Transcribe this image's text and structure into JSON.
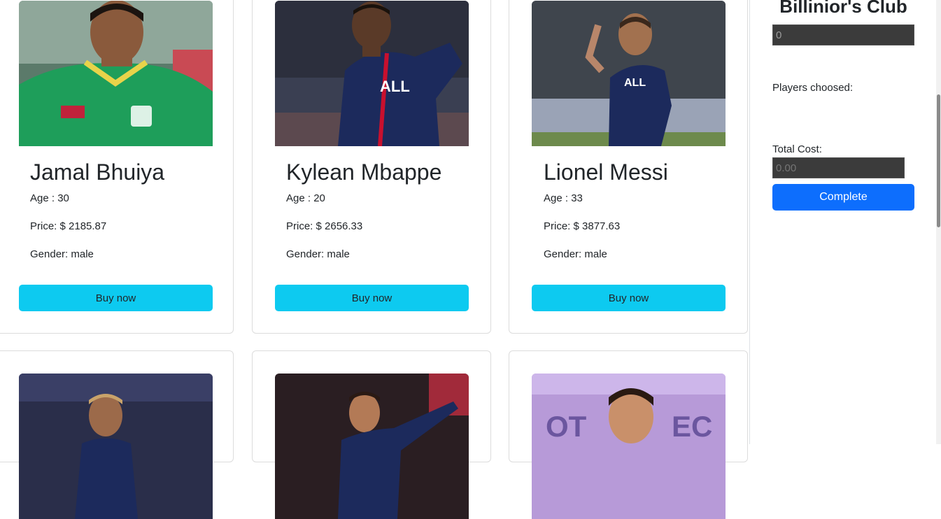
{
  "cards": [
    {
      "name": "Jamal Bhuiya",
      "age": "Age : 30",
      "price": "Price: $ 2185.87",
      "gender": "Gender: male",
      "button": "Buy now",
      "photo": "player-green-kit-photo"
    },
    {
      "name": "Kylean Mbappe",
      "age": "Age : 20",
      "price": "Price: $ 2656.33",
      "gender": "Gender: male",
      "button": "Buy now",
      "photo": "player-navy-kit-running-photo"
    },
    {
      "name": "Lionel Messi",
      "age": "Age : 33",
      "price": "Price: $ 3877.63",
      "gender": "Gender: male",
      "button": "Buy now",
      "photo": "player-navy-kit-standing-photo"
    },
    {
      "photo": "player-dark-background-photo"
    },
    {
      "photo": "player-pointing-photo"
    },
    {
      "photo": "player-purple-background-photo"
    }
  ],
  "sidebar": {
    "title": "Billinior's Club",
    "budget_value": "0",
    "players_label": "Players choosed:",
    "total_label": "Total Cost:",
    "total_placeholder": "0.00",
    "complete_label": "Complete"
  },
  "colors": {
    "buy_button": "#0dcaf0",
    "complete_button": "#0d6efd",
    "dark_input": "#3b3b3b"
  }
}
